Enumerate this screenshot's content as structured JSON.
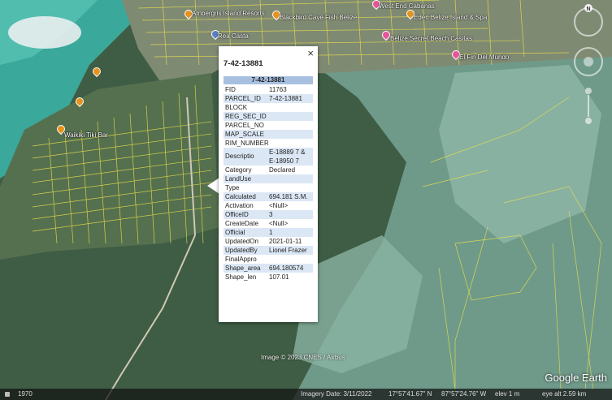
{
  "places": {
    "p1": "Ambergris Island Resorts",
    "p2": "Blackbird Caye Fish Belize",
    "p3": "West End Cabanas",
    "p4": "Eden Belize Island & Spa",
    "p5": "Rea Casta",
    "p6": "Belize Secret Beach Casitas",
    "p7": "El Fin Del Mundo",
    "p8": "Waikiki Tiki Bar"
  },
  "popup": {
    "title": "7-42-13881",
    "header": "7-42-13881",
    "close": "×",
    "rows": [
      {
        "k": "FID",
        "v": "11763"
      },
      {
        "k": "PARCEL_ID",
        "v": "7-42-13881"
      },
      {
        "k": "BLOCK",
        "v": ""
      },
      {
        "k": "REG_SEC_ID",
        "v": ""
      },
      {
        "k": "PARCEL_NO",
        "v": ""
      },
      {
        "k": "MAP_SCALE",
        "v": ""
      },
      {
        "k": "RIM_NUMBER",
        "v": ""
      },
      {
        "k": "Descriptio",
        "v": "E-18889 7 & E-18950 7"
      },
      {
        "k": "Category",
        "v": "Declared"
      },
      {
        "k": "LandUse",
        "v": ""
      },
      {
        "k": "Type",
        "v": ""
      },
      {
        "k": "Calculated",
        "v": "694.181 S.M."
      },
      {
        "k": "Activation",
        "v": "<Null>"
      },
      {
        "k": "OfficeID",
        "v": "3"
      },
      {
        "k": "CreateDate",
        "v": "<Null>"
      },
      {
        "k": "Official",
        "v": "1"
      },
      {
        "k": "UpdatedOn",
        "v": "2021-01-11"
      },
      {
        "k": "UpdatedBy",
        "v": "Lionel Frazer"
      },
      {
        "k": "FinalAppro",
        "v": ""
      },
      {
        "k": "Shape_area",
        "v": "694.180574"
      },
      {
        "k": "Shape_len",
        "v": "107.01"
      }
    ]
  },
  "nav": {
    "north": "N"
  },
  "copyright": "Image © 2023 CNES / Airbus",
  "logo": "Google Earth",
  "status": {
    "year": "1970",
    "imagery": "Imagery Date: 3/11/2022",
    "lat": "17°57'41.67\" N",
    "lon": "87°57'24.76\" W",
    "elev": "elev   1 m",
    "eye": "eye alt   2.59 km"
  }
}
